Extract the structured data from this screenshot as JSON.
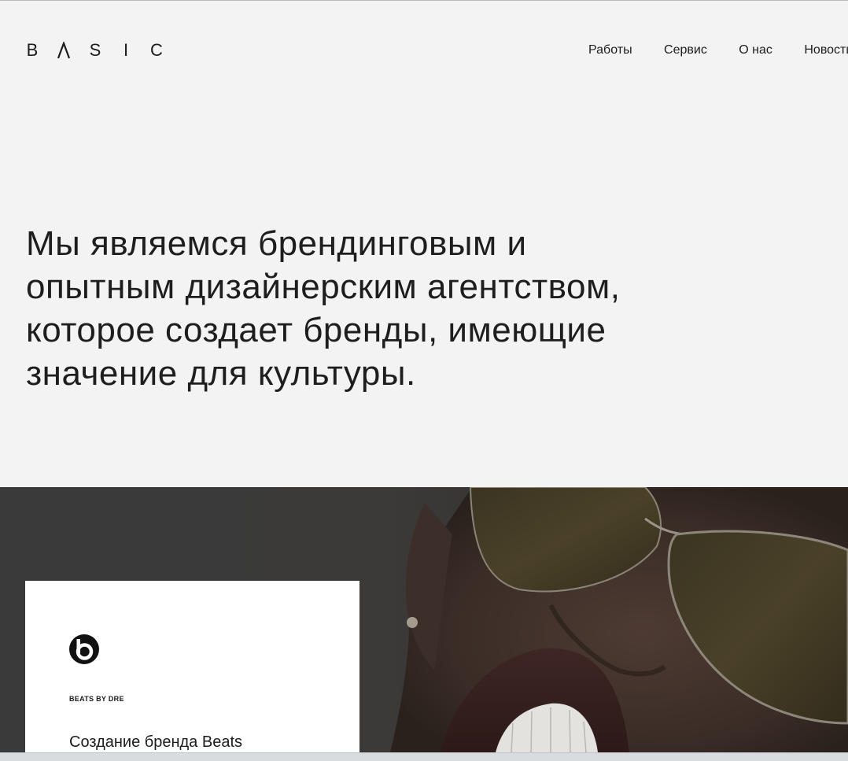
{
  "brand": {
    "letters": [
      "B",
      "S",
      "I",
      "C"
    ]
  },
  "nav": {
    "items": [
      {
        "label": "Работы"
      },
      {
        "label": "Сервис"
      },
      {
        "label": "О нас"
      },
      {
        "label": "Новости"
      }
    ]
  },
  "hero": {
    "lines": [
      "Мы являемся брендинговым и",
      "опытным дизайнерским агентством,",
      "которое создает бренды, имеющие",
      "значение для культуры."
    ]
  },
  "feature": {
    "client": "BEATS BY DRE",
    "title": "Создание бренда Beats",
    "logo_icon": "beats-b-logo"
  },
  "colors": {
    "page_background": "#f3f3f3",
    "band_background": "#3a3a3a",
    "card_background": "#ffffff",
    "text": "#1c1c1c"
  }
}
